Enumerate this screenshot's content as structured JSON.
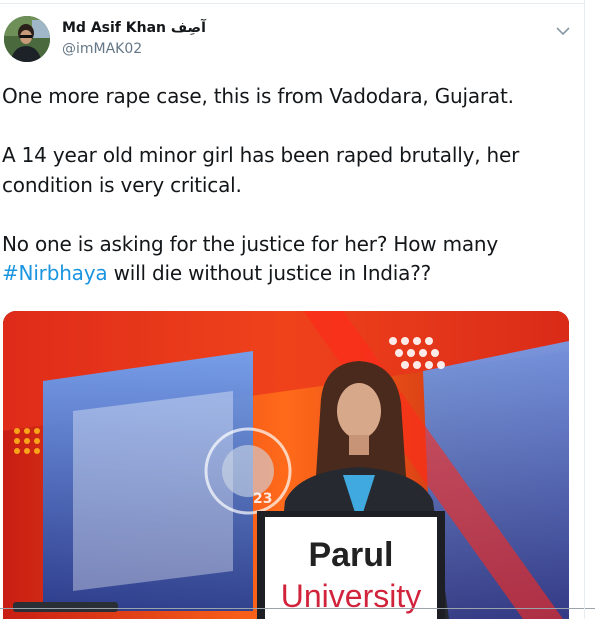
{
  "tweet": {
    "author": {
      "display_name": "Md Asif Khan آصِف",
      "handle": "@imMAK02",
      "avatar_icon": "profile-photo"
    },
    "menu_icon": "chevron-down-icon",
    "text": {
      "line1": "One more rape case, this is from Vadodara, Gujarat.",
      "line2": "A 14 year old minor girl has been raped brutally, her",
      "line3": "condition is very critical.",
      "line4": "No one is asking for the justice for her? How many",
      "hashtag": "#Nirbhaya",
      "line5_rest": " will die without justice in India??"
    },
    "media": {
      "podium_line1": "Parul",
      "podium_line2": "University",
      "screen_number": "23"
    },
    "colors": {
      "hashtag": "#1b95e0",
      "text": "#14171a",
      "handle": "#657786"
    }
  }
}
